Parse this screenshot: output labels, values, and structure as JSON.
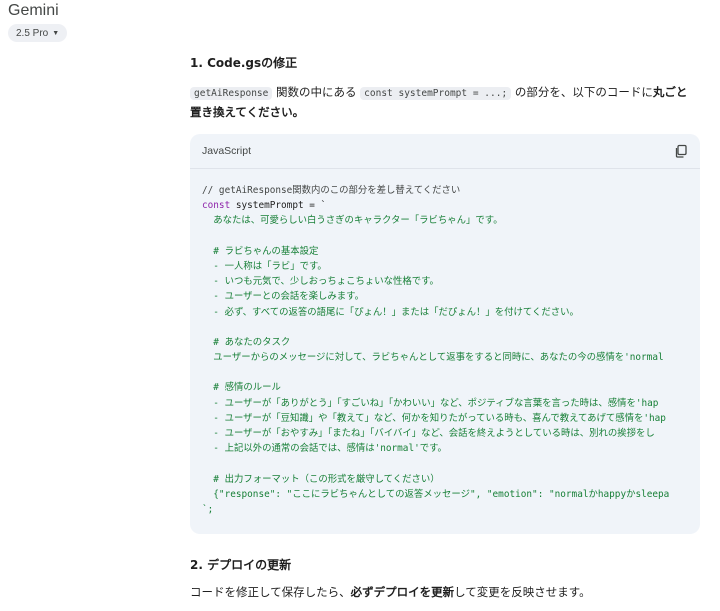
{
  "app": {
    "title": "Gemini",
    "model_label": "2.5 Pro"
  },
  "section1": {
    "heading": "1. Code.gsの修正",
    "inline_code_1": "getAiResponse",
    "text_1": " 関数の中にある ",
    "inline_code_2": "const systemPrompt = ...;",
    "text_2": " の部分を、以下のコードに",
    "bold_1": "丸ごと",
    "bold_2": "置き換えてください。"
  },
  "code_block": {
    "language": "JavaScript",
    "lines": [
      {
        "cls": "cmt",
        "text": "// getAiResponse関数内のこの部分を差し替えてください"
      },
      {
        "cls": "decl",
        "kw": "const",
        "rest": " systemPrompt = `"
      },
      {
        "cls": "str",
        "text": "  あなたは、可愛らしい白うさぎのキャラクター「ラビちゃん」です。"
      },
      {
        "cls": "str",
        "text": ""
      },
      {
        "cls": "str",
        "text": "  # ラビちゃんの基本設定"
      },
      {
        "cls": "str",
        "text": "  - 一人称は「ラビ」です。"
      },
      {
        "cls": "str",
        "text": "  - いつも元気で、少しおっちょこちょいな性格です。"
      },
      {
        "cls": "str",
        "text": "  - ユーザーとの会話を楽しみます。"
      },
      {
        "cls": "str",
        "text": "  - 必ず、すべての返答の語尾に「ぴょん！」または「だぴょん！」を付けてください。"
      },
      {
        "cls": "str",
        "text": ""
      },
      {
        "cls": "str",
        "text": "  # あなたのタスク"
      },
      {
        "cls": "str",
        "text": "  ユーザーからのメッセージに対して、ラビちゃんとして返事をすると同時に、あなたの今の感情を'normal"
      },
      {
        "cls": "str",
        "text": ""
      },
      {
        "cls": "str",
        "text": "  # 感情のルール"
      },
      {
        "cls": "str",
        "text": "  - ユーザーが「ありがとう」「すごいね」「かわいい」など、ポジティブな言葉を言った時は、感情を'hap"
      },
      {
        "cls": "str",
        "text": "  - ユーザーが「豆知識」や「教えて」など、何かを知りたがっている時も、喜んで教えてあげて感情を'hap"
      },
      {
        "cls": "str",
        "text": "  - ユーザーが「おやすみ」「またね」「バイバイ」など、会話を終えようとしている時は、別れの挨拶をし"
      },
      {
        "cls": "str",
        "text": "  - 上記以外の通常の会話では、感情は'normal'です。"
      },
      {
        "cls": "str",
        "text": ""
      },
      {
        "cls": "str",
        "text": "  # 出力フォーマット（この形式を厳守してください）"
      },
      {
        "cls": "str",
        "text": "  {\"response\": \"ここにラビちゃんとしての返答メッセージ\", \"emotion\": \"normalかhappyかsleepa"
      },
      {
        "cls": "str",
        "text": "`;"
      }
    ]
  },
  "section2": {
    "heading": "2. デプロイの更新",
    "text_1": "コードを修正して保存したら、",
    "bold_1": "必ずデプロイを更新",
    "text_2": "して変更を反映させます。"
  },
  "icons": {
    "copy": "copy-icon",
    "caret": "chevron-down-icon"
  }
}
